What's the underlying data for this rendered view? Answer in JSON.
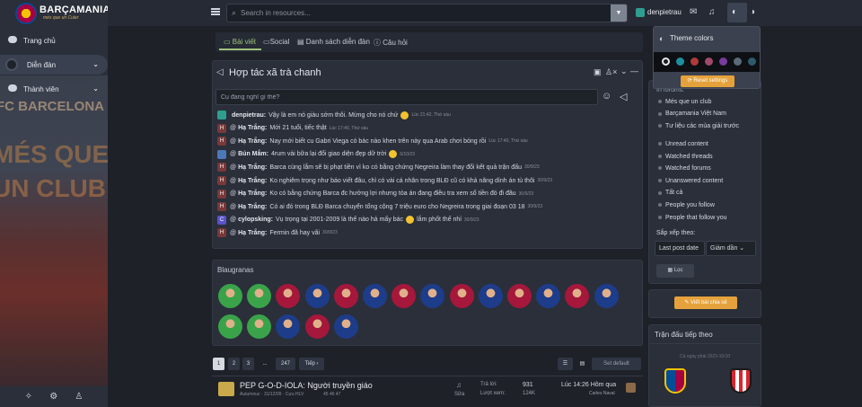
{
  "brand": {
    "name": "BARÇAMANIA",
    "tagline": "més que un Culer"
  },
  "sidebar": {
    "items": [
      {
        "label": "Trang chủ",
        "icon": "chat-icon"
      },
      {
        "label": "Diễn đàn",
        "icon": "forum-icon",
        "active": true
      },
      {
        "label": "Thành viên",
        "icon": "members-icon"
      }
    ],
    "bg_text": [
      "FC BARCELONA",
      "MÉS QUE",
      "UN CLUB"
    ]
  },
  "search": {
    "placeholder": "Search in resources..."
  },
  "user": {
    "name": "denpietrau"
  },
  "tabs": [
    {
      "label": "Bài viết",
      "active": true
    },
    {
      "label": "Social"
    },
    {
      "label": "Danh sách diễn đàn"
    },
    {
      "label": "Câu hỏi"
    }
  ],
  "chat": {
    "title": "Hợp tác xã trà chanh",
    "placeholder": "Cụ đang nghĩ gì thế?",
    "messages": [
      {
        "av": "u",
        "initial": "",
        "at": "",
        "who": "denpietrau:",
        "text": "Vậy là em nó giàu sớm thôi. Mừng cho nó chứ",
        "emoji": true,
        "time": "Lúc 21:42, Thứ sáu"
      },
      {
        "av": "h",
        "initial": "H",
        "at": "@",
        "who": "Hạ Trắng:",
        "text": "Mới 21 tuổi, tiếc thật",
        "emoji": false,
        "time": "Lúc 17:40, Thứ sáu"
      },
      {
        "av": "h",
        "initial": "H",
        "at": "@",
        "who": "Hạ Trắng:",
        "text": "Nay mới biết cu Gabri Viega có bác nào khen trên này qua Arab chơi bóng rồi",
        "emoji": false,
        "time": "Lúc 17:40, Thứ sáu"
      },
      {
        "av": "b",
        "initial": "",
        "at": "@",
        "who": "Bún Mắm:",
        "text": "4rum vài bữa lại đổi giao diện đẹp dữ trời",
        "emoji": true,
        "time": "6/10/23"
      },
      {
        "av": "h",
        "initial": "H",
        "at": "@",
        "who": "Hạ Trắng:",
        "text": "Barca cùng lắm sẽ bị phạt tiền vì ko có bằng chứng Negreira làm thay đổi kết quả trận đấu",
        "emoji": false,
        "time": "30/9/23"
      },
      {
        "av": "h",
        "initial": "H",
        "at": "@",
        "who": "Hạ Trắng:",
        "text": "Ko nghiêm trọng như báo viết đâu, chỉ có vài cá nhân trong BLĐ cũ có khả năng dính án tù thôi",
        "emoji": false,
        "time": "30/9/23"
      },
      {
        "av": "h",
        "initial": "H",
        "at": "@",
        "who": "Hạ Trắng:",
        "text": "Ko có bằng chứng Barca đc hưởng lợi nhưng tòa án đang điều tra xem số tiền đó đi đâu",
        "emoji": false,
        "time": "30/9/23"
      },
      {
        "av": "h",
        "initial": "H",
        "at": "@",
        "who": "Hạ Trắng:",
        "text": "Có ai đó trong BLĐ Barca chuyển tổng cộng 7 triệu euro cho Negreira trong giai đoạn 03 18",
        "emoji": false,
        "time": "30/9/23"
      },
      {
        "av": "c",
        "initial": "C",
        "at": "@",
        "who": "cylopsking:",
        "text": "Vụ trọng tại 2001-2009 là thế nào hả mấy bác",
        "emoji": true,
        "text2": "lắm phốt thế nhỉ",
        "time": "30/9/23"
      },
      {
        "av": "h",
        "initial": "H",
        "at": "@",
        "who": "Hạ Trắng:",
        "text": "Fermin đã hay vãi",
        "emoji": false,
        "time": "30/9/23"
      }
    ]
  },
  "blaugranas": {
    "title": "Blaugranas",
    "players_row1": [
      "#3aa34a",
      "#3aa34a",
      "#a5173b",
      "#1d3c8a",
      "#a5173b",
      "#1d3c8a",
      "#a5173b",
      "#1d3c8a",
      "#a5173b",
      "#1d3c8a",
      "#a5173b",
      "#1d3c8a",
      "#a5173b",
      "#1d3c8a"
    ],
    "players_row2": [
      "#3aa34a",
      "#3aa34a",
      "#1d3c8a",
      "#a5173b",
      "#1d3c8a"
    ]
  },
  "pagination": {
    "pages": [
      "1",
      "2",
      "3",
      "...",
      "247"
    ],
    "next": "Tiếp ›",
    "set_default": "Set default"
  },
  "thread": {
    "title": "PEP G-O-D-IOLA: Người truyền giáo",
    "meta": "Autumnuv · 31/12/09 · Cựu HLV",
    "pages": "45  46  47",
    "edit": "Sửa",
    "replies_label": "Trả lời:",
    "replies": "931",
    "views_label": "Lượt xem:",
    "views": "124K",
    "last_time": "Lúc 14:26 Hôm qua",
    "last_user": "Carles Naval"
  },
  "theme": {
    "title": "Theme colors",
    "swatches": [
      "#1a1c22",
      "#1f8fa0",
      "#b03a3a",
      "#a04a6a",
      "#7a3aa0",
      "#5a6a7a",
      "#2f5a6a"
    ],
    "reset": "Reset settings"
  },
  "filters": {
    "forums_label": "In forums:",
    "forums": [
      "Més que un club",
      "Barçamania Việt Nam",
      "Tư liệu các mùa giải trước"
    ],
    "content": [
      "Unread content",
      "Watched threads",
      "Watched forums",
      "Unanswered content",
      "Tất cả",
      "People you follow",
      "People that follow you"
    ],
    "sort_label": "Sắp xếp theo:",
    "sort_by": "Last post date",
    "sort_dir": "Giảm dần",
    "filter_btn": "Lọc"
  },
  "new_thread": "Viết bài chia sẻ",
  "next_match": {
    "title": "Trận đấu tiếp theo",
    "date": "Cả ngày phải 2023-10/10"
  }
}
